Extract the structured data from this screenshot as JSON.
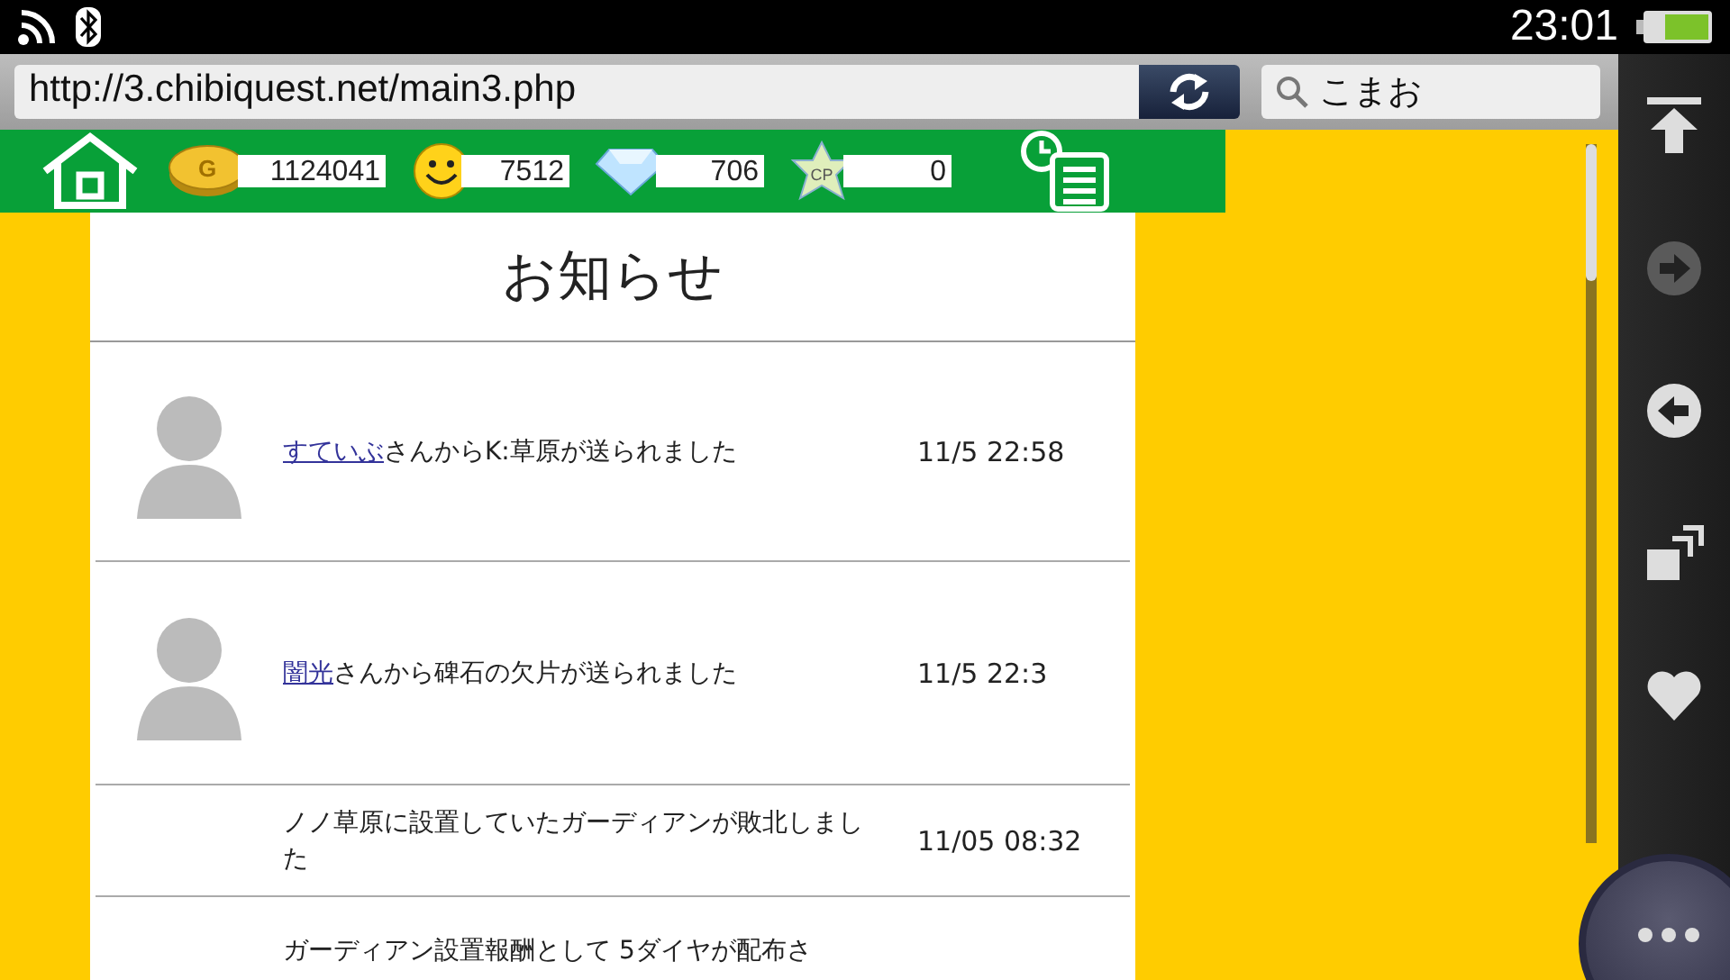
{
  "status_bar": {
    "time": "23:01"
  },
  "browser": {
    "url": "http://3.chibiquest.net/main3.php",
    "search": "こまお"
  },
  "header": {
    "stats": [
      {
        "kind": "gold",
        "icon_text": "G",
        "value": "1124041"
      },
      {
        "kind": "smile",
        "value": "7512"
      },
      {
        "kind": "diamond",
        "value": "706"
      },
      {
        "kind": "cp",
        "icon_text": "CP",
        "value": "0"
      }
    ]
  },
  "notices": {
    "title": "お知らせ",
    "items": [
      {
        "avatar": true,
        "sender": "すていぶ",
        "message": "さんからK:草原が送られました",
        "time": "11/5 22:58"
      },
      {
        "avatar": true,
        "sender": "闇光",
        "message": "さんから碑石の欠片が送られました",
        "time": "11/5 22:3"
      },
      {
        "avatar": false,
        "message": "ノノ草原に設置していたガーディアンが敗北しました",
        "time": "11/05 08:32"
      },
      {
        "avatar": false,
        "message": "ガーディアン設置報酬として 5ダイヤが配布さ"
      }
    ]
  },
  "side_buttons": [
    {
      "kind": "top",
      "disabled": false
    },
    {
      "kind": "forward",
      "disabled": true
    },
    {
      "kind": "back",
      "disabled": false
    },
    {
      "kind": "tabs",
      "disabled": false
    },
    {
      "kind": "favorite",
      "disabled": false
    }
  ]
}
